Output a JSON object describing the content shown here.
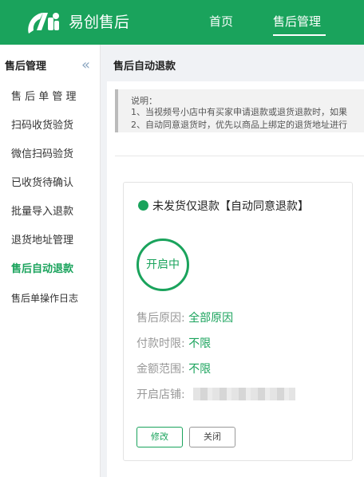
{
  "header": {
    "brand": "易创售后",
    "nav": [
      {
        "label": "首页"
      },
      {
        "label": "售后管理"
      }
    ],
    "colors": {
      "primary": "#1aa35c"
    }
  },
  "sidebar": {
    "title": "售后管理",
    "collapse_icon": "double-chevron-left-icon",
    "items": [
      {
        "label": "售 后 单 管 理"
      },
      {
        "label": "扫码收货验货"
      },
      {
        "label": "微信扫码验货"
      },
      {
        "label": "已收货待确认"
      },
      {
        "label": "批量导入退款"
      },
      {
        "label": "退货地址管理"
      },
      {
        "label": "售后自动退款"
      },
      {
        "label": "售后单操作日志"
      }
    ],
    "active_index": 6
  },
  "main": {
    "breadcrumb": "售后自动退款",
    "note": {
      "title": "说明：",
      "line1": "1、当视频号小店中有买家申请退款或退货退款时，如果",
      "line2": "2、自动同意退货时，优先以商品上绑定的退货地址进行"
    },
    "card": {
      "title": "未发货仅退款【自动同意退款】",
      "status": "开启中",
      "rows": [
        {
          "label": "售后原因:",
          "value": "全部原因"
        },
        {
          "label": "付款时限:",
          "value": "不限"
        },
        {
          "label": "金额范围:",
          "value": "不限"
        },
        {
          "label": "开启店铺:",
          "value": ""
        }
      ],
      "edit_label": "修改",
      "close_label": "关闭"
    }
  }
}
